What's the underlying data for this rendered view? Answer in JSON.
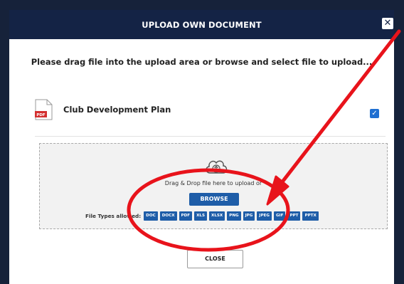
{
  "modal": {
    "title": "UPLOAD OWN DOCUMENT",
    "close_icon": "close-icon",
    "instruction": "Please drag file into the upload area or browse and select file to upload..."
  },
  "document": {
    "name": "Club Development Plan",
    "icon_label": "PDF",
    "selected": true
  },
  "dropzone": {
    "drag_text": "Drag & Drop file here to upload or",
    "browse_label": "BROWSE",
    "filetypes_label": "File Types allowed:",
    "filetypes": [
      "DOC",
      "DOCX",
      "PDF",
      "XLS",
      "XLSX",
      "PNG",
      "JPG",
      "JPEG",
      "GIF",
      "PPT",
      "PPTX"
    ]
  },
  "footer": {
    "close_label": "CLOSE"
  },
  "colors": {
    "header_bg": "#142345",
    "accent": "#1e5da8",
    "checkbox": "#1f6fd1",
    "annotation": "#e8131b"
  }
}
